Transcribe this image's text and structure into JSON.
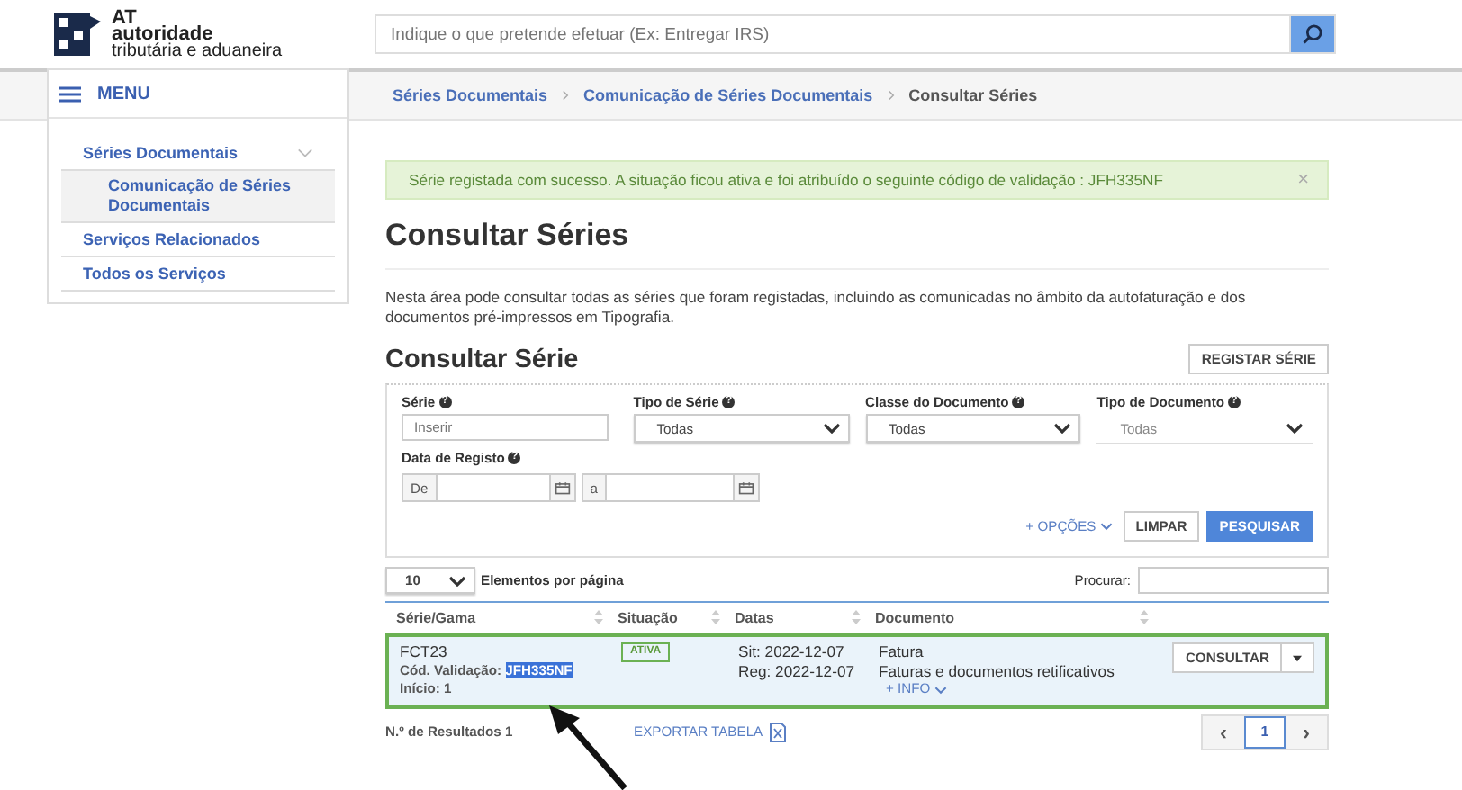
{
  "header": {
    "logo": {
      "abbr": "AT",
      "line1": "autoridade",
      "line2": "tributária e aduaneira"
    },
    "search": {
      "placeholder": "Indique o que pretende efetuar (Ex: Entregar IRS)"
    }
  },
  "menu": {
    "label": "MENU",
    "items": [
      {
        "label": "Séries Documentais",
        "expanded": true,
        "children": [
          {
            "label": "Comunicação de Séries Documentais",
            "selected": true
          }
        ]
      },
      {
        "label": "Serviços Relacionados",
        "selected": false
      },
      {
        "label": "Todos os Serviços",
        "selected": false
      }
    ]
  },
  "breadcrumb": [
    {
      "label": "Séries Documentais",
      "current": false
    },
    {
      "label": "Comunicação de Séries Documentais",
      "current": false
    },
    {
      "label": "Consultar Séries",
      "current": true
    }
  ],
  "alert": {
    "text": "Série registada com sucesso. A situação ficou ativa e foi atribuído o seguinte código de validação : JFH335NF",
    "close": "×"
  },
  "title": "Consultar Séries",
  "intro": "Nesta área pode consultar todas as séries que foram registadas, incluindo as comunicadas no âmbito da autofaturação e dos documentos pré-impressos em Tipografia.",
  "section": {
    "title": "Consultar Série",
    "button": "REGISTAR SÉRIE"
  },
  "filters": [
    {
      "kind": "text",
      "label": "Série",
      "help": "?",
      "placeholder": "Inserir"
    },
    {
      "kind": "select",
      "label": "Tipo de Série",
      "help": "?",
      "value": "Todas",
      "disabled": false
    },
    {
      "kind": "select",
      "label": "Classe do Documento",
      "help": "?",
      "value": "Todas",
      "disabled": false
    },
    {
      "kind": "select",
      "label": "Tipo de Documento",
      "help": "?",
      "value": "Todas",
      "disabled": true
    }
  ],
  "date_range": {
    "label": "Data de Registo",
    "help": "?",
    "from": "De",
    "to": "a"
  },
  "options_link": "+ OPÇÕES",
  "clear_button": "LIMPAR",
  "search_button": "PESQUISAR",
  "page_size": {
    "value": "10",
    "label": "Elementos por página"
  },
  "table_search": {
    "label": "Procurar:"
  },
  "table": {
    "columns": [
      "Série/Gama",
      "Situação",
      "Datas",
      "Documento"
    ],
    "rows": [
      {
        "selected": true,
        "serie": "FCT23",
        "code_label": "Cód. Validação:",
        "code": "JFH335NF",
        "code_highlighted": true,
        "start": "Início: 1",
        "status": "ATIVA",
        "dates": [
          "Sit: 2022-12-07",
          "Reg: 2022-12-07"
        ],
        "document": [
          "Fatura",
          "Faturas e documentos retificativos"
        ],
        "more": "+ INFO",
        "action": "CONSULTAR"
      }
    ]
  },
  "results": "N.º de Resultados 1",
  "export": "EXPORTAR TABELA",
  "pagination": {
    "prev": "‹",
    "next": "›",
    "pages": [
      {
        "label": "1",
        "selected": true
      }
    ]
  },
  "annotation": {
    "arrow": true
  }
}
